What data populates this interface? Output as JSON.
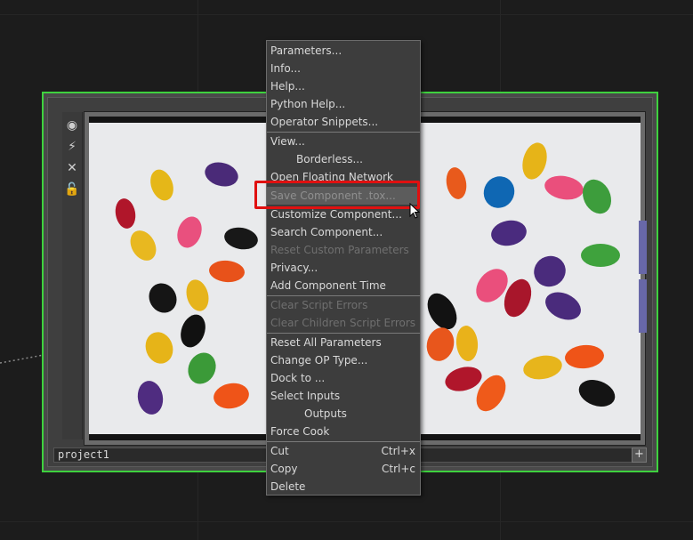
{
  "node": {
    "name": "project1",
    "add_button": "+"
  },
  "toolbar_icons": [
    "viewer-toggle-icon",
    "bypass-icon",
    "close-icon",
    "lock-icon"
  ],
  "menu": {
    "items": [
      {
        "label": "Parameters...",
        "enabled": true
      },
      {
        "label": "Info...",
        "enabled": true
      },
      {
        "label": "Help...",
        "enabled": true
      },
      {
        "label": "Python Help...",
        "enabled": true
      },
      {
        "label": "Operator Snippets...",
        "enabled": true
      },
      {
        "label": "View...",
        "enabled": true
      },
      {
        "label": "Borderless...",
        "enabled": true
      },
      {
        "label": "Open Floating Network",
        "enabled": true
      },
      {
        "label": "Save Component .tox...",
        "enabled": true
      },
      {
        "label": "Customize Component...",
        "enabled": true
      },
      {
        "label": "Search Component...",
        "enabled": true
      },
      {
        "label": "Reset Custom Parameters",
        "enabled": false
      },
      {
        "label": "Privacy...",
        "enabled": true
      },
      {
        "label": "Add Component Time",
        "enabled": true
      },
      {
        "label": "Clear Script Errors",
        "enabled": false
      },
      {
        "label": "Clear Children Script Errors",
        "enabled": false
      },
      {
        "label": "Reset All Parameters",
        "enabled": true
      },
      {
        "label": "Change OP Type...",
        "enabled": true
      },
      {
        "label": "Dock to ...",
        "enabled": true
      },
      {
        "label": "Select Inputs",
        "enabled": true
      },
      {
        "label": "Outputs",
        "enabled": true
      },
      {
        "label": "Force Cook",
        "enabled": true
      },
      {
        "label": "Cut",
        "shortcut": "Ctrl+x",
        "enabled": true
      },
      {
        "label": "Copy",
        "shortcut": "Ctrl+c",
        "enabled": true
      },
      {
        "label": "Delete",
        "enabled": true
      }
    ]
  },
  "colors": {
    "node_selected_border": "#3ed13e",
    "highlight_box": "#e01010",
    "menu_bg": "#3d3d3d",
    "menu_text": "#d9d9d9",
    "menu_disabled_text": "#6f6f6f"
  }
}
